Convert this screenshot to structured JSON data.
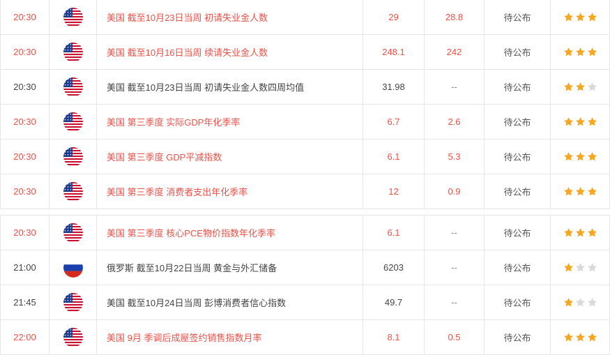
{
  "colors": {
    "highlight": "#e8534a",
    "normal": "#444444",
    "star_on": "#f5a623",
    "star_off": "#d9d9d9",
    "grid": "#e6e6e6"
  },
  "rows": [
    {
      "time": "20:30",
      "flag": "us-flag-icon",
      "event": "美国 截至10月23日当周 初请失业金人数",
      "actual": "29",
      "previous": "28.8",
      "forecast": "待公布",
      "stars": 3,
      "highlight": true
    },
    {
      "time": "20:30",
      "flag": "us-flag-icon",
      "event": "美国 截至10月16日当周 续请失业金人数",
      "actual": "248.1",
      "previous": "242",
      "forecast": "待公布",
      "stars": 3,
      "highlight": true
    },
    {
      "time": "20:30",
      "flag": "us-flag-icon",
      "event": "美国 截至10月23日当周 初请失业金人数四周均值",
      "actual": "31.98",
      "previous": "--",
      "forecast": "待公布",
      "stars": 2,
      "highlight": false
    },
    {
      "time": "20:30",
      "flag": "us-flag-icon",
      "event": "美国 第三季度 实际GDP年化季率",
      "actual": "6.7",
      "previous": "2.6",
      "forecast": "待公布",
      "stars": 3,
      "highlight": true
    },
    {
      "time": "20:30",
      "flag": "us-flag-icon",
      "event": "美国 第三季度 GDP平减指数",
      "actual": "6.1",
      "previous": "5.3",
      "forecast": "待公布",
      "stars": 3,
      "highlight": true
    },
    {
      "time": "20:30",
      "flag": "us-flag-icon",
      "event": "美国 第三季度 消费者支出年化季率",
      "actual": "12",
      "previous": "0.9",
      "forecast": "待公布",
      "stars": 3,
      "highlight": true
    },
    {
      "time": "20:30",
      "flag": "us-flag-icon",
      "event": "美国 第三季度 核心PCE物价指数年化季率",
      "actual": "6.1",
      "previous": "--",
      "forecast": "待公布",
      "stars": 3,
      "highlight": true
    },
    {
      "time": "21:00",
      "flag": "russia-flag-icon",
      "event": "俄罗斯 截至10月22日当周 黄金与外汇储备",
      "actual": "6203",
      "previous": "--",
      "forecast": "待公布",
      "stars": 1,
      "highlight": false
    },
    {
      "time": "21:45",
      "flag": "us-flag-icon",
      "event": "美国 截至10月24日当周 彭博消费者信心指数",
      "actual": "49.7",
      "previous": "--",
      "forecast": "待公布",
      "stars": 1,
      "highlight": false
    },
    {
      "time": "22:00",
      "flag": "us-flag-icon",
      "event": "美国 9月 季调后成屋签约销售指数月率",
      "actual": "8.1",
      "previous": "0.5",
      "forecast": "待公布",
      "stars": 3,
      "highlight": true
    }
  ]
}
